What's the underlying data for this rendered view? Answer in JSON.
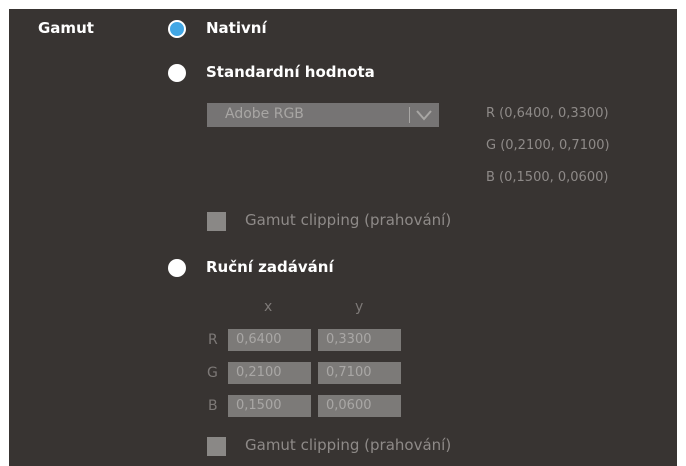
{
  "gamut": {
    "label": "Gamut",
    "options": {
      "native": {
        "label": "Nativní",
        "selected": true
      },
      "standard": {
        "label": "Standardní hodnota",
        "selected": false
      },
      "manual": {
        "label": "Ruční zadávání",
        "selected": false
      }
    },
    "standard": {
      "select_value": "Adobe RGB",
      "coords": {
        "r": "R (0,6400, 0,3300)",
        "g": "G (0,2100, 0,7100)",
        "b": "B (0,1500, 0,0600)"
      },
      "clipping_label": "Gamut clipping (prahování)"
    },
    "manual": {
      "col_x": "x",
      "col_y": "y",
      "rows": [
        {
          "letter": "R",
          "x": "0,6400",
          "y": "0,3300"
        },
        {
          "letter": "G",
          "x": "0,2100",
          "y": "0,7100"
        },
        {
          "letter": "B",
          "x": "0,1500",
          "y": "0,0600"
        }
      ],
      "clipping_label": "Gamut clipping (prahování)"
    }
  },
  "colors": {
    "panel_bg": "#383432",
    "radio_selected": "#42a7e5",
    "text_primary": "#ffffff",
    "text_disabled": "#8e8a88"
  },
  "icons": {
    "select_arrow": "chevron-down-icon"
  }
}
